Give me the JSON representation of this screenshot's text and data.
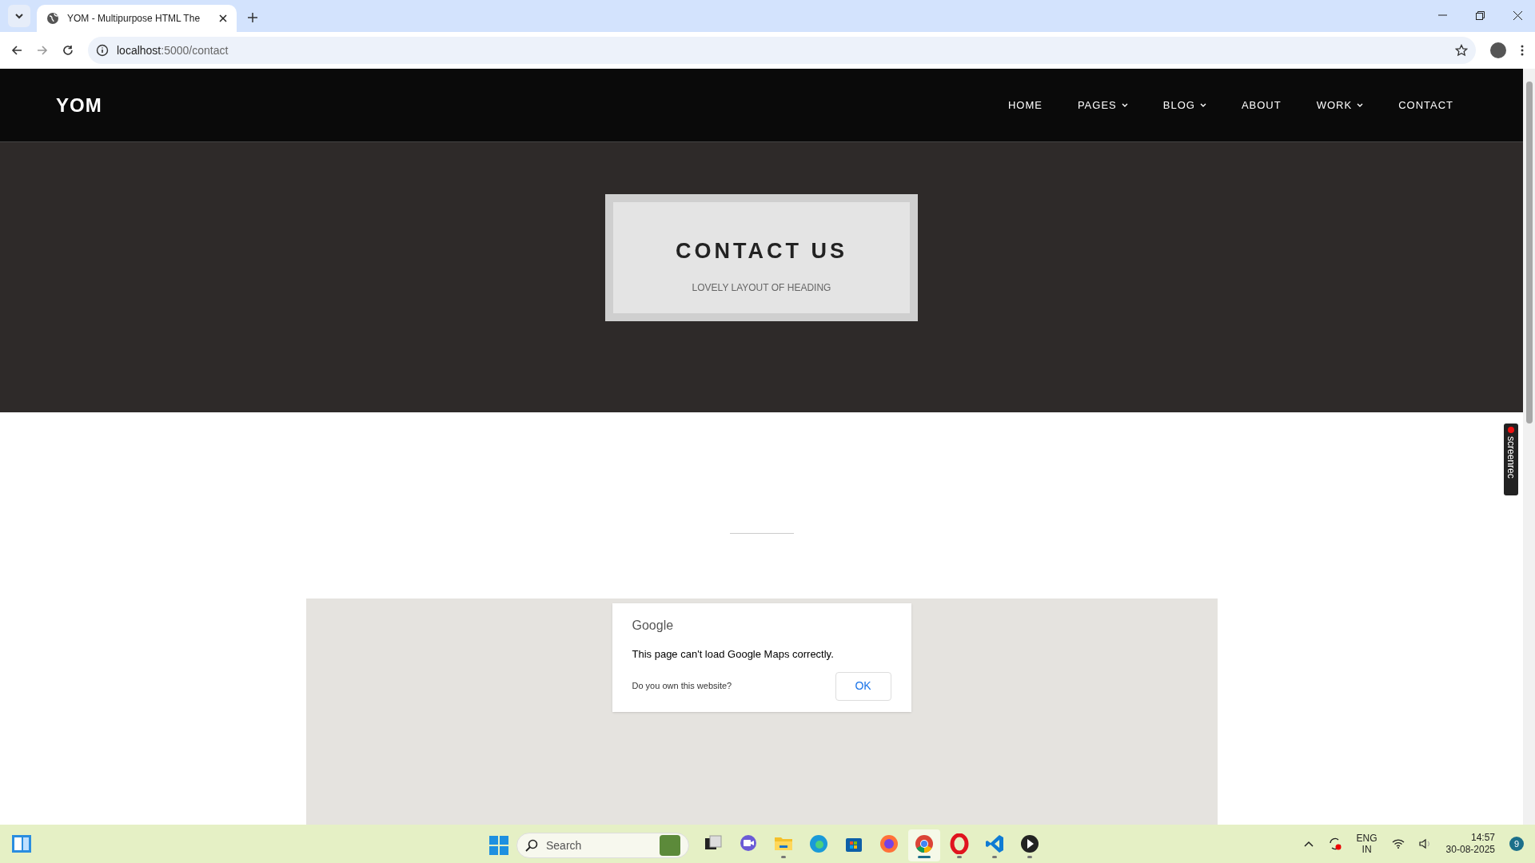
{
  "browser": {
    "tab_title": "YOM - Multipurpose HTML The",
    "url_host": "localhost",
    "url_path": ":5000/contact"
  },
  "site": {
    "logo": "YOM",
    "nav": [
      {
        "label": "HOME",
        "dropdown": false
      },
      {
        "label": "PAGES",
        "dropdown": true
      },
      {
        "label": "BLOG",
        "dropdown": true
      },
      {
        "label": "ABOUT",
        "dropdown": false
      },
      {
        "label": "WORK",
        "dropdown": true
      },
      {
        "label": "CONTACT",
        "dropdown": false
      }
    ]
  },
  "hero": {
    "title": "CONTACT US",
    "subtitle": "LOVELY LAYOUT OF HEADING"
  },
  "map_error": {
    "brand": "Google",
    "message": "This page can't load Google Maps correctly.",
    "link": "Do you own this website?",
    "button": "OK"
  },
  "recorder": {
    "label": "screenrec"
  },
  "taskbar": {
    "search_placeholder": "Search",
    "apps": [
      {
        "kind": "taskview",
        "running": false,
        "selected": false
      },
      {
        "kind": "meet",
        "running": false,
        "selected": false
      },
      {
        "kind": "files",
        "running": true,
        "selected": false
      },
      {
        "kind": "edge",
        "running": false,
        "selected": false
      },
      {
        "kind": "store",
        "running": false,
        "selected": false
      },
      {
        "kind": "firefox",
        "running": false,
        "selected": false
      },
      {
        "kind": "chrome",
        "running": true,
        "selected": true
      },
      {
        "kind": "opera",
        "running": true,
        "selected": false
      },
      {
        "kind": "vscode",
        "running": true,
        "selected": false
      },
      {
        "kind": "player",
        "running": true,
        "selected": false
      }
    ],
    "lang": "ENG",
    "region": "IN",
    "time": "14:57",
    "date": "30-08-2025",
    "notifications": "9"
  }
}
